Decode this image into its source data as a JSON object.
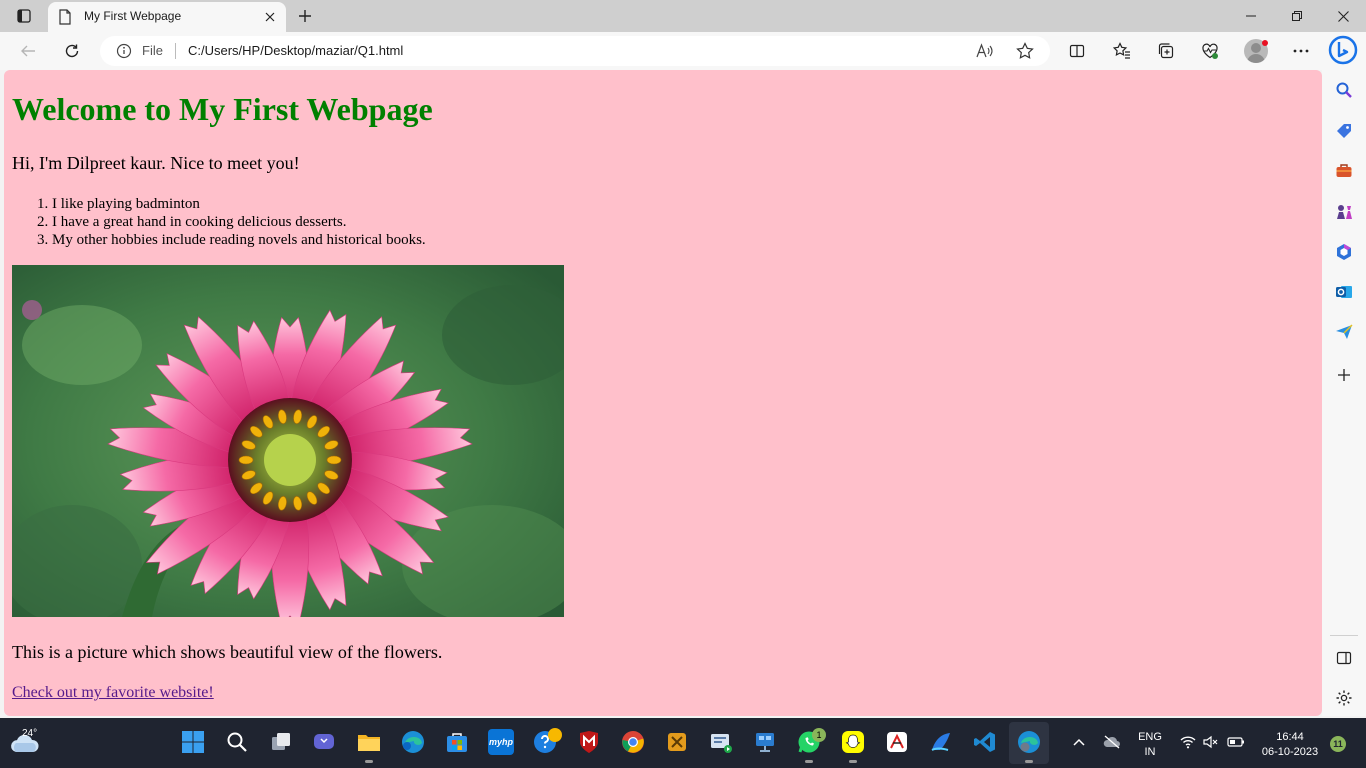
{
  "browser": {
    "tab": {
      "title": "My First Webpage"
    },
    "address_bar": {
      "protocol_label": "File",
      "url": "C:/Users/HP/Desktop/maziar/Q1.html"
    }
  },
  "page": {
    "heading": "Welcome to My First Webpage",
    "intro": "Hi, I'm Dilpreet kaur. Nice to meet you!",
    "list": [
      "I like playing badminton",
      "I have a great hand in cooking delicious desserts.",
      "My other hobbies include reading novels and historical books."
    ],
    "caption": "This is a picture which shows beautiful view of the flowers.",
    "link_text": "Check out my favorite website!",
    "background_color": "#ffc0cb",
    "heading_color": "#008000"
  },
  "sidebar": {
    "icons": [
      "search-icon",
      "tag-icon",
      "briefcase-icon",
      "games-icon",
      "office-icon",
      "outlook-icon",
      "send-icon",
      "add-icon",
      "sidebar-toggle-icon",
      "settings-icon"
    ]
  },
  "taskbar": {
    "weather_temp": "24°",
    "whatsapp_badge": "1",
    "language": "ENG",
    "region": "IN",
    "time": "16:44",
    "date": "06-10-2023",
    "notification_count": "11",
    "myhp_label": "myhp"
  }
}
